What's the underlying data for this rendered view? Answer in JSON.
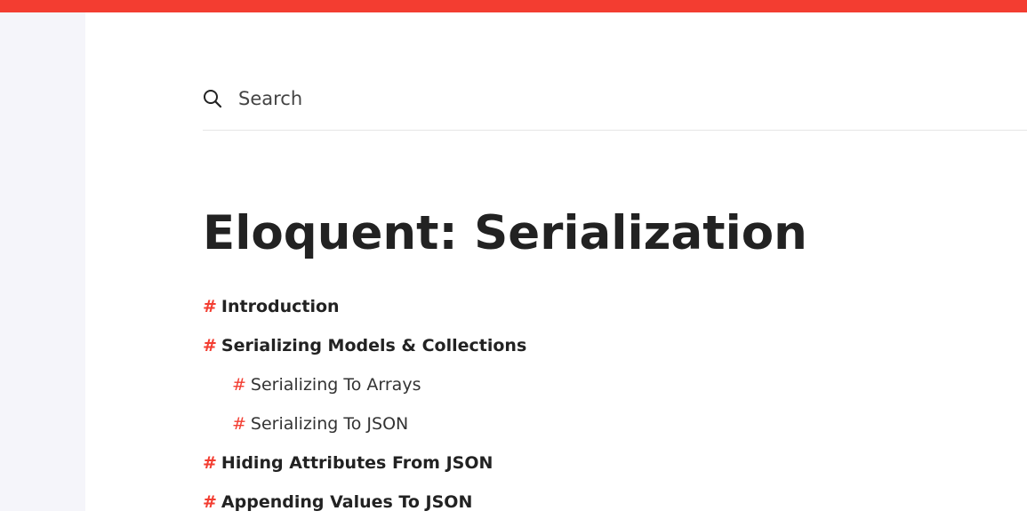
{
  "colors": {
    "accent": "#f33d31",
    "sidebar_bg": "#f5f5fa",
    "text": "#222222"
  },
  "search": {
    "placeholder": "Search",
    "value": "",
    "icon": "search-icon"
  },
  "page": {
    "title": "Eloquent: Serialization"
  },
  "toc": {
    "marker": "#",
    "items": [
      {
        "label": "Introduction",
        "level": 1
      },
      {
        "label": "Serializing Models & Collections",
        "level": 1
      },
      {
        "label": "Serializing To Arrays",
        "level": 2
      },
      {
        "label": "Serializing To JSON",
        "level": 2
      },
      {
        "label": "Hiding Attributes From JSON",
        "level": 1
      },
      {
        "label": "Appending Values To JSON",
        "level": 1
      }
    ]
  }
}
